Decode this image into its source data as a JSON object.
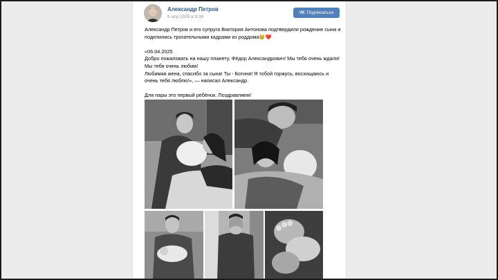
{
  "post": {
    "author": "Александр Петров",
    "date": "9 апр 2025 в 9:38",
    "subscribe_label": "Подписаться",
    "subscribe_icon": "vk-logo-icon",
    "text": {
      "p1": "Александр Петров и его супруга Виктория Антонова подтвердили рождение сына и поделились трогательными кадрами из роддома",
      "p1_emoji": "🥹❤️",
      "p2": "«06.04.2025\nДобро пожаловать на нашу планету, Фёдор Александрович! Мы тебя очень ждали! Мы тебя очень любим!\nЛюбимая жена, спасибо за сына! Ты - Богиня! Я тобой горжусь, восхищаюсь и очень тебя люблю!», — написал Александр.",
      "p3": "Для пары это первый ребёнок. Поздравляем!"
    },
    "photos": [
      {
        "name": "photo-couple-bed",
        "tone": "#8a8a8a"
      },
      {
        "name": "photo-husband-kiss",
        "tone": "#7a7a7a"
      },
      {
        "name": "photo-father-holding-baby",
        "tone": "#8c8c8c"
      },
      {
        "name": "photo-father-emotional",
        "tone": "#9a9a9a"
      },
      {
        "name": "photo-baby-feet",
        "tone": "#5a5a5a"
      }
    ]
  },
  "colors": {
    "link": "#2a5885",
    "button": "#5181b8",
    "muted": "#939393"
  }
}
